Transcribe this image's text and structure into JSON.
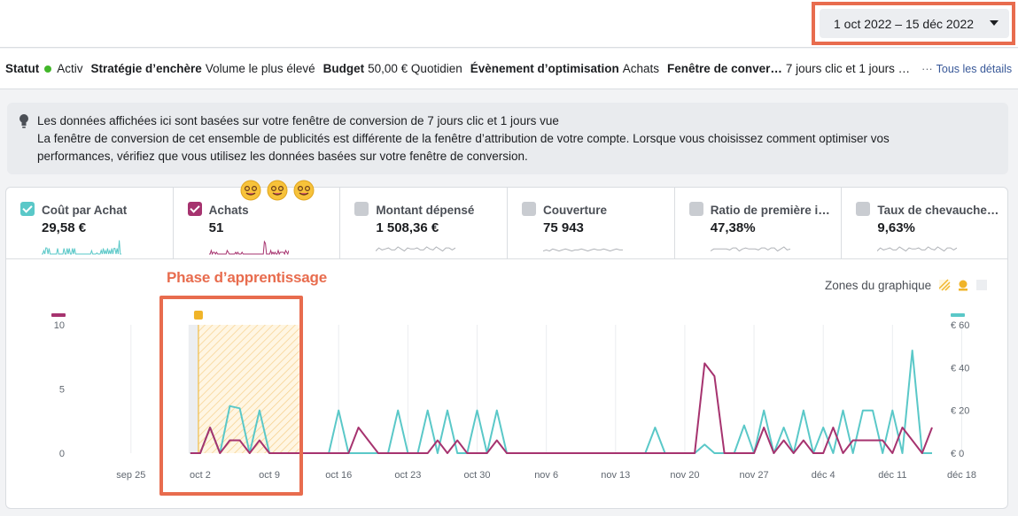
{
  "header": {
    "date_range": "1 oct 2022 – 15 déc 2022"
  },
  "status_bar": {
    "status_label": "Statut",
    "status_value": "Activ",
    "bid_label": "Stratégie d’enchère",
    "bid_value": "Volume le plus élevé",
    "budget_label": "Budget",
    "budget_value": "50,00 € Quotidien",
    "optim_label": "Évènement d’optimisation",
    "optim_value": "Achats",
    "window_label": "Fenêtre de conver…",
    "window_value": "7 jours clic et 1 jours …",
    "details_ellipsis": "···",
    "details_link": "Tous les détails"
  },
  "info": {
    "line1": "Les données affichées ici sont basées sur votre fenêtre de conversion de 7 jours clic et 1 jours vue",
    "line2": "La fenêtre de conversion de cet ensemble de publicités est différente de la fenêtre d’attribution de votre compte. Lorsque vous choisissez comment optimiser vos",
    "line3": "performances, vérifiez que vous utilisez les données basées sur votre fenêtre de conversion."
  },
  "metrics": [
    {
      "label": "Coût par Achat",
      "value": "29,58 €",
      "checked": true,
      "color": "#5ac8c8"
    },
    {
      "label": "Achats",
      "value": "51",
      "checked": true,
      "color": "#a6336f"
    },
    {
      "label": "Montant dépensé",
      "value": "1 508,36 €",
      "checked": false,
      "color": "#b0b3b8"
    },
    {
      "label": "Couverture",
      "value": "75 943",
      "checked": false,
      "color": "#b0b3b8"
    },
    {
      "label": "Ratio de première i…",
      "value": "47,38%",
      "checked": false,
      "color": "#b0b3b8"
    },
    {
      "label": "Taux de chevauche…",
      "value": "9,63%",
      "checked": false,
      "color": "#b0b3b8"
    }
  ],
  "chart_labels": {
    "phase": "Phase d’apprentissage",
    "zones": "Zones du graphique"
  },
  "chart_data": {
    "type": "line",
    "x": [
      "2022-09-20",
      "2022-09-21",
      "2022-09-22",
      "2022-09-23",
      "2022-09-24",
      "2022-09-25",
      "2022-09-26",
      "2022-09-27",
      "2022-09-28",
      "2022-09-29",
      "2022-09-30",
      "2022-10-01",
      "2022-10-02",
      "2022-10-03",
      "2022-10-04",
      "2022-10-05",
      "2022-10-06",
      "2022-10-07",
      "2022-10-08",
      "2022-10-09",
      "2022-10-10",
      "2022-10-11",
      "2022-10-12",
      "2022-10-13",
      "2022-10-14",
      "2022-10-15",
      "2022-10-16",
      "2022-10-17",
      "2022-10-18",
      "2022-10-19",
      "2022-10-20",
      "2022-10-21",
      "2022-10-22",
      "2022-10-23",
      "2022-10-24",
      "2022-10-25",
      "2022-10-26",
      "2022-10-27",
      "2022-10-28",
      "2022-10-29",
      "2022-10-30",
      "2022-10-31",
      "2022-11-01",
      "2022-11-02",
      "2022-11-03",
      "2022-11-04",
      "2022-11-05",
      "2022-11-06",
      "2022-11-07",
      "2022-11-08",
      "2022-11-09",
      "2022-11-10",
      "2022-11-11",
      "2022-11-12",
      "2022-11-13",
      "2022-11-14",
      "2022-11-15",
      "2022-11-16",
      "2022-11-17",
      "2022-11-18",
      "2022-11-19",
      "2022-11-20",
      "2022-11-21",
      "2022-11-22",
      "2022-11-23",
      "2022-11-24",
      "2022-11-25",
      "2022-11-26",
      "2022-11-27",
      "2022-11-28",
      "2022-11-29",
      "2022-11-30",
      "2022-12-01",
      "2022-12-02",
      "2022-12-03",
      "2022-12-04",
      "2022-12-05",
      "2022-12-06",
      "2022-12-07",
      "2022-12-08",
      "2022-12-09",
      "2022-12-10",
      "2022-12-11",
      "2022-12-12",
      "2022-12-13",
      "2022-12-14",
      "2022-12-15"
    ],
    "series": [
      {
        "name": "Achats",
        "axis": "left",
        "color": "#a6336f",
        "values": [
          null,
          null,
          null,
          null,
          null,
          null,
          null,
          null,
          null,
          null,
          null,
          0,
          0,
          2,
          0,
          1,
          1,
          0,
          1,
          0,
          0,
          0,
          0,
          0,
          0,
          0,
          0,
          0,
          2,
          1,
          0,
          0,
          0,
          0,
          0,
          0,
          1,
          0,
          1,
          0,
          0,
          0,
          1,
          0,
          0,
          0,
          0,
          0,
          0,
          0,
          0,
          0,
          0,
          0,
          0,
          0,
          0,
          0,
          0,
          0,
          0,
          0,
          0,
          7,
          6,
          0,
          0,
          0,
          0,
          2,
          0,
          1,
          0,
          1,
          0,
          0,
          2,
          0,
          1,
          1,
          1,
          1,
          0,
          2,
          1,
          0,
          2
        ]
      },
      {
        "name": "Coût par Achat",
        "axis": "right",
        "color": "#5ac8c8",
        "values": [
          null,
          null,
          null,
          null,
          null,
          null,
          null,
          null,
          null,
          null,
          null,
          0,
          0,
          12,
          0,
          22,
          21,
          0,
          20,
          0,
          0,
          0,
          0,
          0,
          0,
          0,
          20,
          0,
          0,
          0,
          0,
          0,
          20,
          0,
          0,
          20,
          0,
          20,
          0,
          0,
          20,
          0,
          20,
          0,
          0,
          0,
          0,
          0,
          0,
          0,
          0,
          0,
          0,
          0,
          0,
          0,
          0,
          0,
          12,
          0,
          0,
          0,
          0,
          4,
          0,
          0,
          0,
          13,
          0,
          20,
          0,
          12,
          0,
          20,
          0,
          12,
          0,
          20,
          0,
          20,
          20,
          0,
          20,
          0,
          48,
          0,
          0
        ]
      }
    ],
    "x_ticks": [
      "sep 25",
      "oct 2",
      "oct 9",
      "oct 16",
      "oct 23",
      "oct 30",
      "nov 6",
      "nov 13",
      "nov 20",
      "nov 27",
      "déc 4",
      "déc 11",
      "déc 18"
    ],
    "y_left_ticks": [
      "0",
      "5",
      "10"
    ],
    "y_right_ticks": [
      "€ 0",
      "€ 20",
      "€ 40",
      "€ 60"
    ],
    "y_left_range": [
      0,
      10
    ],
    "y_right_range": [
      0,
      60
    ],
    "learning_phase": {
      "start": "2022-10-01",
      "end": "2022-10-12"
    },
    "grid": "vertical"
  }
}
